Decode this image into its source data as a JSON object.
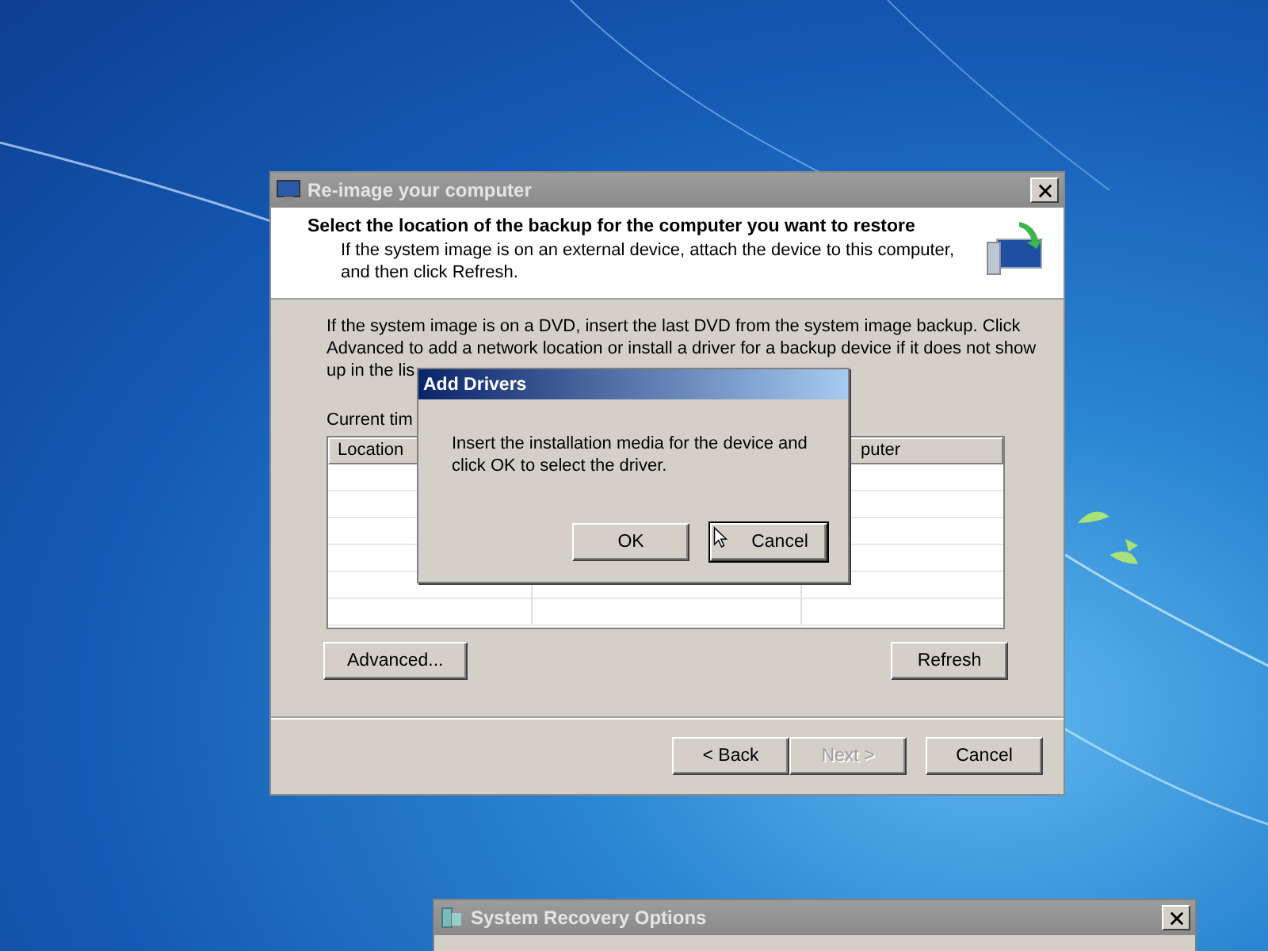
{
  "main_window": {
    "title": "Re-image your computer",
    "heading": "Select the location of the backup for the computer you want to restore",
    "subheading": "If the system image is on an external device, attach the device to this computer, and then click Refresh.",
    "instructions": "If the system image is on a DVD, insert the last DVD from the system image backup. Click Advanced to add a network location or install a driver for a backup device if it does not show up in the lis",
    "current_time_label": "Current tim",
    "table": {
      "columns": [
        "Location",
        "",
        "puter"
      ]
    },
    "buttons": [
      {
        "label": "Advanced...",
        "disabled": false
      },
      {
        "label": "Refresh",
        "disabled": false
      }
    ],
    "footer_buttons": [
      {
        "label": "< Back",
        "disabled": false
      },
      {
        "label": "Next >",
        "disabled": true
      },
      {
        "label": "Cancel",
        "disabled": false
      }
    ]
  },
  "dialog": {
    "title": "Add Drivers",
    "message": "Insert the installation media for the device and click OK to select the driver.",
    "buttons": [
      {
        "label": "OK",
        "focused": false
      },
      {
        "label": "Cancel",
        "focused": true
      }
    ]
  },
  "background_window": {
    "title": "System Recovery Options"
  }
}
